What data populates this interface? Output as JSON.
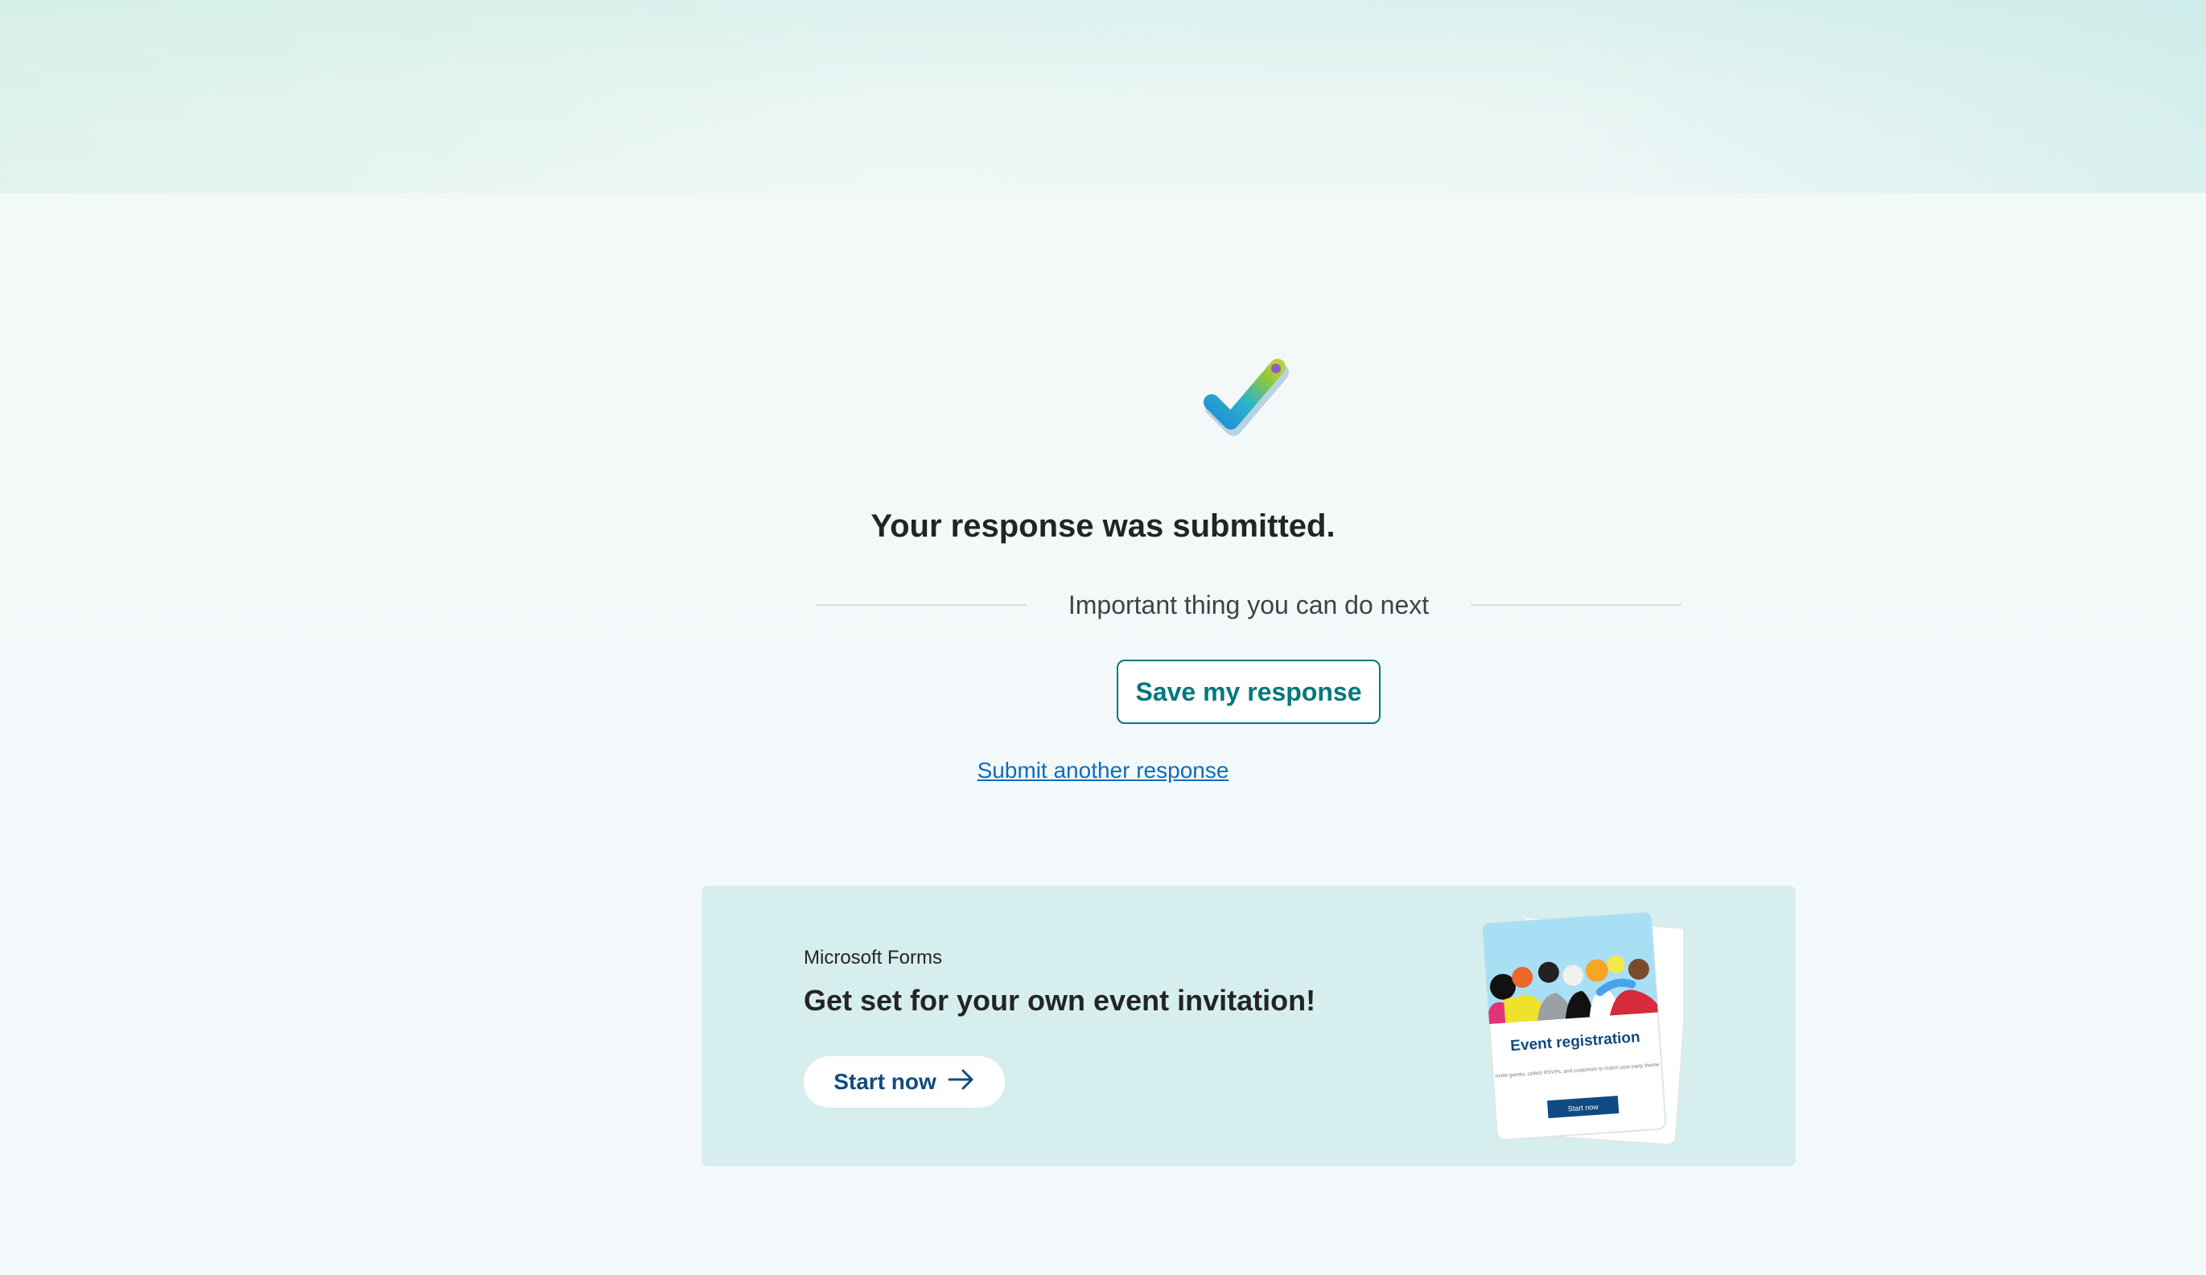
{
  "confirmation": {
    "title": "Your response was submitted.",
    "divider_text": "Important thing you can do next",
    "save_button": "Save my response",
    "another_link": "Submit another response",
    "check_icon": "checkmark-icon"
  },
  "promo": {
    "brand": "Microsoft Forms",
    "heading": "Get set for your own event invitation!",
    "start_button": "Start now",
    "arrow_icon": "arrow-right-icon",
    "card": {
      "title": "Event registration",
      "description": "Invite guests, collect RSVPs, and customize to match your party theme",
      "button": "Start now"
    }
  },
  "colors": {
    "accent_teal": "#03787c",
    "link_blue": "#0f6cbd",
    "promo_bg": "#d7eeef",
    "dark_blue": "#0f4b82"
  }
}
